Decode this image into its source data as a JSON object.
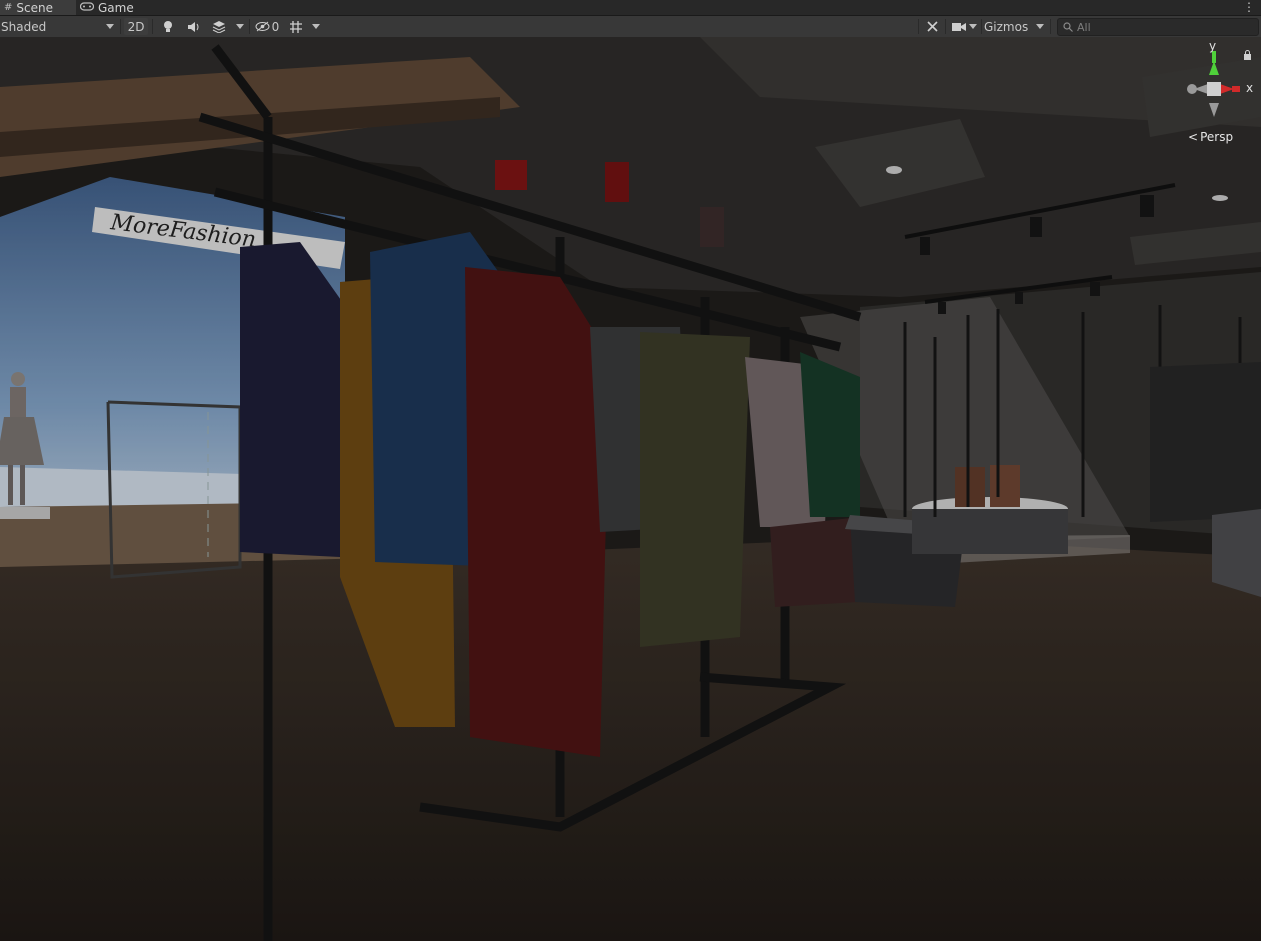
{
  "tabs": [
    {
      "label": "Scene",
      "icon": "grid-icon"
    },
    {
      "label": "Game",
      "icon": "gamepad-icon"
    }
  ],
  "toolbar": {
    "shading_mode": "Shaded",
    "mode_2d": "2D",
    "hidden_count": "0",
    "gizmos": "Gizmos",
    "search_placeholder": "All"
  },
  "orientation_gizmo": {
    "y_label": "y",
    "x_label": "x",
    "projection": "Persp"
  },
  "scene": {
    "sign_text": "MoreFashion"
  },
  "colors": {
    "tabbar": "#282828",
    "toolbar": "#383838",
    "gizmo_y": "#4fd13a",
    "gizmo_x": "#d12a2a"
  }
}
